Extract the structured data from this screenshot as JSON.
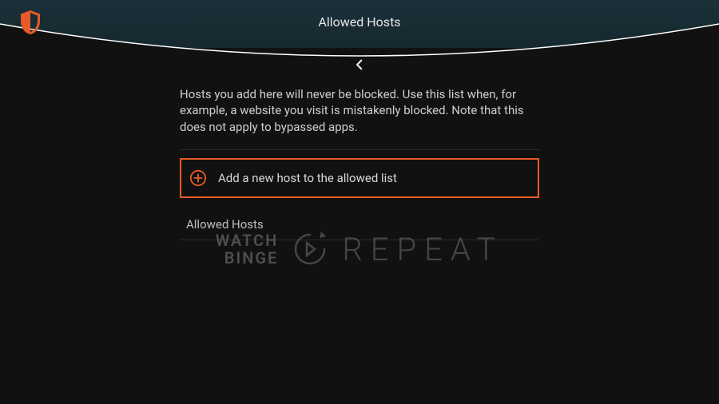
{
  "colors": {
    "accent": "#e85a27",
    "bg": "#111"
  },
  "header": {
    "title": "Allowed Hosts"
  },
  "logo_name": "shield-icon",
  "description": "Hosts you add here will never be blocked. Use this list when, for example, a website you visit is mistakenly blocked. Note that this does not apply to bypassed apps.",
  "add_host": {
    "label": "Add a new host to the allowed list"
  },
  "section": {
    "label": "Allowed Hosts"
  },
  "watermark": {
    "line1": "WATCH",
    "line2": "BINGE",
    "right": "REPEAT"
  }
}
